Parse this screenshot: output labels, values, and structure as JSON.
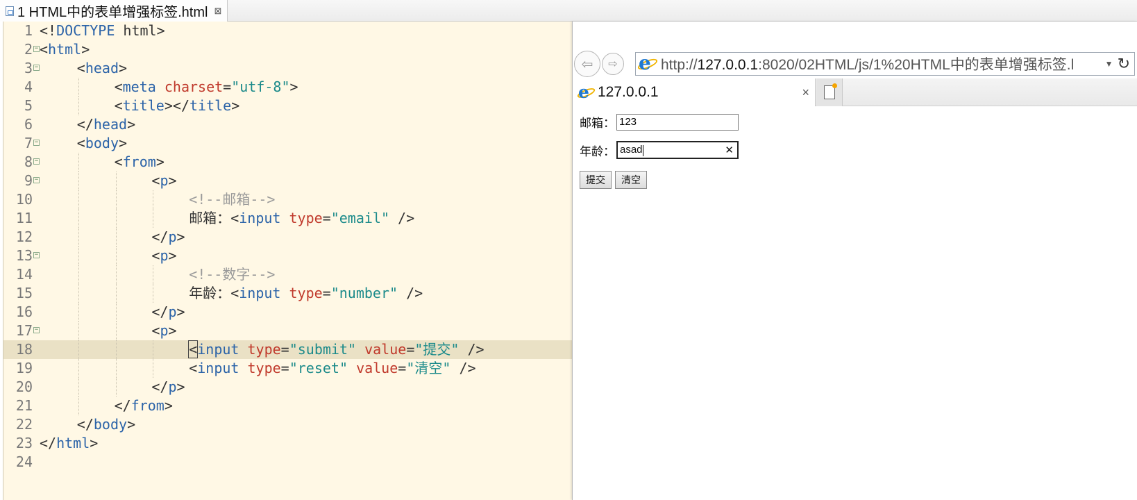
{
  "editor": {
    "tab_title": "1 HTML中的表单增强标签.html",
    "tab_close": "⊠",
    "current_line": 18,
    "lines": [
      {
        "n": "1",
        "fold": false,
        "indent": 0,
        "tokens": [
          [
            "punct",
            "<!"
          ],
          [
            "kw",
            "DOCTYPE"
          ],
          [
            "text",
            " html"
          ],
          [
            "punct",
            ">"
          ]
        ]
      },
      {
        "n": "2",
        "fold": true,
        "indent": 0,
        "tokens": [
          [
            "punct",
            "<"
          ],
          [
            "tag",
            "html"
          ],
          [
            "punct",
            ">"
          ]
        ]
      },
      {
        "n": "3",
        "fold": true,
        "indent": 1,
        "tokens": [
          [
            "punct",
            "<"
          ],
          [
            "tag",
            "head"
          ],
          [
            "punct",
            ">"
          ]
        ]
      },
      {
        "n": "4",
        "fold": false,
        "indent": 2,
        "tokens": [
          [
            "punct",
            "<"
          ],
          [
            "tag",
            "meta"
          ],
          [
            "text",
            " "
          ],
          [
            "attr",
            "charset"
          ],
          [
            "punct",
            "="
          ],
          [
            "val",
            "\"utf-8\""
          ],
          [
            "punct",
            ">"
          ]
        ]
      },
      {
        "n": "5",
        "fold": false,
        "indent": 2,
        "tokens": [
          [
            "punct",
            "<"
          ],
          [
            "tag",
            "title"
          ],
          [
            "punct",
            "></"
          ],
          [
            "tag",
            "title"
          ],
          [
            "punct",
            ">"
          ]
        ]
      },
      {
        "n": "6",
        "fold": false,
        "indent": 1,
        "tokens": [
          [
            "punct",
            "</"
          ],
          [
            "tag",
            "head"
          ],
          [
            "punct",
            ">"
          ]
        ]
      },
      {
        "n": "7",
        "fold": true,
        "indent": 1,
        "tokens": [
          [
            "punct",
            "<"
          ],
          [
            "tag",
            "body"
          ],
          [
            "punct",
            ">"
          ]
        ]
      },
      {
        "n": "8",
        "fold": true,
        "indent": 2,
        "tokens": [
          [
            "punct",
            "<"
          ],
          [
            "tag",
            "from"
          ],
          [
            "punct",
            ">"
          ]
        ]
      },
      {
        "n": "9",
        "fold": true,
        "indent": 3,
        "tokens": [
          [
            "punct",
            "<"
          ],
          [
            "tag",
            "p"
          ],
          [
            "punct",
            ">"
          ]
        ]
      },
      {
        "n": "10",
        "fold": false,
        "indent": 4,
        "tokens": [
          [
            "comment",
            "<!--邮箱-->"
          ]
        ]
      },
      {
        "n": "11",
        "fold": false,
        "indent": 4,
        "tokens": [
          [
            "text",
            "邮箱："
          ],
          [
            "punct",
            "<"
          ],
          [
            "tag",
            "input"
          ],
          [
            "text",
            " "
          ],
          [
            "attr",
            "type"
          ],
          [
            "punct",
            "="
          ],
          [
            "val",
            "\"email\""
          ],
          [
            "punct",
            " />"
          ]
        ]
      },
      {
        "n": "12",
        "fold": false,
        "indent": 3,
        "tokens": [
          [
            "punct",
            "</"
          ],
          [
            "tag",
            "p"
          ],
          [
            "punct",
            ">"
          ]
        ]
      },
      {
        "n": "13",
        "fold": true,
        "indent": 3,
        "tokens": [
          [
            "punct",
            "<"
          ],
          [
            "tag",
            "p"
          ],
          [
            "punct",
            ">"
          ]
        ]
      },
      {
        "n": "14",
        "fold": false,
        "indent": 4,
        "tokens": [
          [
            "comment",
            "<!--数字-->"
          ]
        ]
      },
      {
        "n": "15",
        "fold": false,
        "indent": 4,
        "tokens": [
          [
            "text",
            "年龄："
          ],
          [
            "punct",
            "<"
          ],
          [
            "tag",
            "input"
          ],
          [
            "text",
            " "
          ],
          [
            "attr",
            "type"
          ],
          [
            "punct",
            "="
          ],
          [
            "val",
            "\"number\""
          ],
          [
            "punct",
            " />"
          ]
        ]
      },
      {
        "n": "16",
        "fold": false,
        "indent": 3,
        "tokens": [
          [
            "punct",
            "</"
          ],
          [
            "tag",
            "p"
          ],
          [
            "punct",
            ">"
          ]
        ]
      },
      {
        "n": "17",
        "fold": true,
        "indent": 3,
        "tokens": [
          [
            "punct",
            "<"
          ],
          [
            "tag",
            "p"
          ],
          [
            "punct",
            ">"
          ]
        ]
      },
      {
        "n": "18",
        "fold": false,
        "indent": 4,
        "tokens": [
          [
            "cursor",
            "<"
          ],
          [
            "tag",
            "input"
          ],
          [
            "text",
            " "
          ],
          [
            "attr",
            "type"
          ],
          [
            "punct",
            "="
          ],
          [
            "val",
            "\"submit\""
          ],
          [
            "text",
            " "
          ],
          [
            "attr",
            "value"
          ],
          [
            "punct",
            "="
          ],
          [
            "val",
            "\"提交\""
          ],
          [
            "punct",
            " />"
          ]
        ]
      },
      {
        "n": "19",
        "fold": false,
        "indent": 4,
        "tokens": [
          [
            "punct",
            "<"
          ],
          [
            "tag",
            "input"
          ],
          [
            "text",
            " "
          ],
          [
            "attr",
            "type"
          ],
          [
            "punct",
            "="
          ],
          [
            "val",
            "\"reset\""
          ],
          [
            "text",
            " "
          ],
          [
            "attr",
            "value"
          ],
          [
            "punct",
            "="
          ],
          [
            "val",
            "\"清空\""
          ],
          [
            "punct",
            " />"
          ]
        ]
      },
      {
        "n": "20",
        "fold": false,
        "indent": 3,
        "tokens": [
          [
            "punct",
            "</"
          ],
          [
            "tag",
            "p"
          ],
          [
            "punct",
            ">"
          ]
        ]
      },
      {
        "n": "21",
        "fold": false,
        "indent": 2,
        "tokens": [
          [
            "punct",
            "</"
          ],
          [
            "tag",
            "from"
          ],
          [
            "punct",
            ">"
          ]
        ]
      },
      {
        "n": "22",
        "fold": false,
        "indent": 1,
        "tokens": [
          [
            "punct",
            "</"
          ],
          [
            "tag",
            "body"
          ],
          [
            "punct",
            ">"
          ]
        ]
      },
      {
        "n": "23",
        "fold": false,
        "indent": 0,
        "tokens": [
          [
            "punct",
            "</"
          ],
          [
            "tag",
            "html"
          ],
          [
            "punct",
            ">"
          ]
        ]
      },
      {
        "n": "24",
        "fold": false,
        "indent": 0,
        "tokens": []
      }
    ]
  },
  "browser": {
    "back_icon": "⇦",
    "forward_icon": "⇨",
    "url_prefix": "http://",
    "url_host": "127.0.0.1",
    "url_rest": ":8020/02HTML/js/1%20HTML中的表单增强标签.l",
    "dropdown_icon": "▼",
    "refresh_icon": "↻",
    "tab_title": "127.0.0.1",
    "tab_close": "×",
    "form": {
      "email_label": "邮箱：",
      "email_value": "123",
      "age_label": "年龄：",
      "age_value": "asad",
      "clear_icon": "✕",
      "submit_label": "提交",
      "reset_label": "清空"
    }
  }
}
